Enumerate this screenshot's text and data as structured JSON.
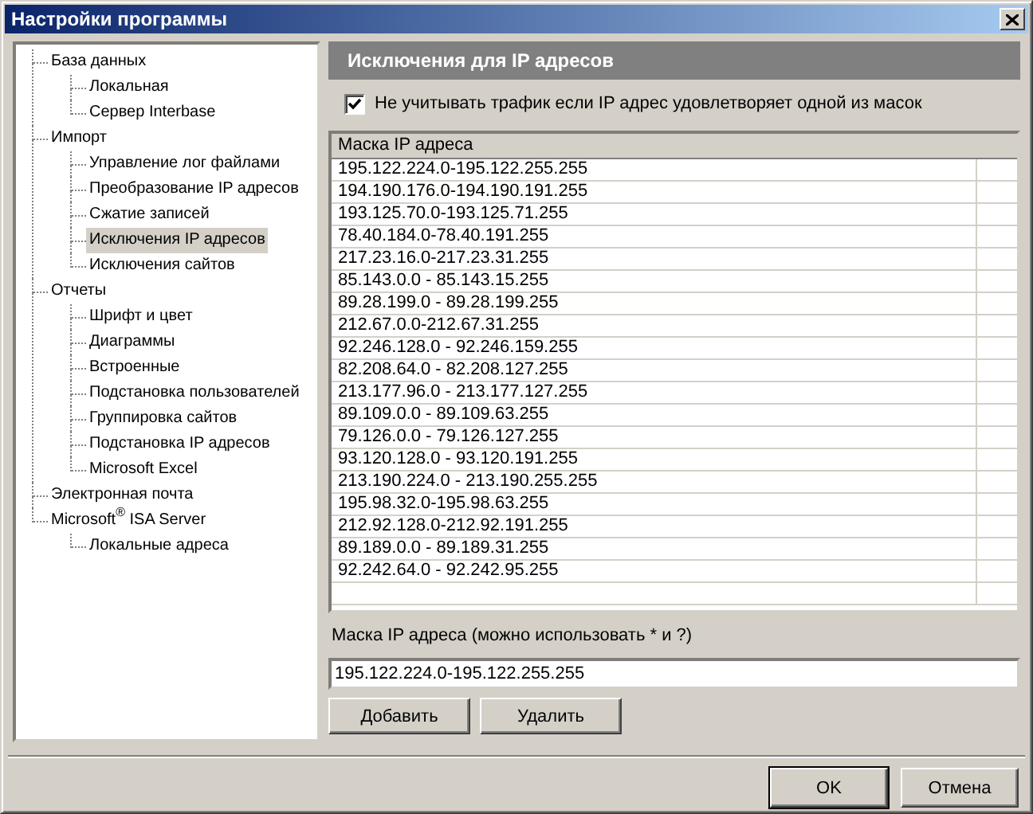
{
  "window": {
    "title": "Настройки программы"
  },
  "tree": [
    {
      "label": "База данных",
      "selected": false,
      "children": [
        {
          "label": "Локальная",
          "selected": false
        },
        {
          "label": "Сервер Interbase",
          "selected": false
        }
      ]
    },
    {
      "label": "Импорт",
      "selected": false,
      "children": [
        {
          "label": "Управление лог файлами",
          "selected": false
        },
        {
          "label": "Преобразование IP адресов",
          "selected": false
        },
        {
          "label": "Сжатие записей",
          "selected": false
        },
        {
          "label": "Исключения IP адресов",
          "selected": true
        },
        {
          "label": "Исключения сайтов",
          "selected": false
        }
      ]
    },
    {
      "label": "Отчеты",
      "selected": false,
      "children": [
        {
          "label": "Шрифт и цвет",
          "selected": false
        },
        {
          "label": "Диаграммы",
          "selected": false
        },
        {
          "label": "Встроенные",
          "selected": false
        },
        {
          "label": "Подстановка пользователей",
          "selected": false
        },
        {
          "label": "Группировка сайтов",
          "selected": false
        },
        {
          "label": "Подстановка IP адресов",
          "selected": false
        },
        {
          "label": "Microsoft Excel",
          "selected": false
        }
      ]
    },
    {
      "label": "Электронная почта",
      "selected": false
    },
    {
      "label": "Microsoft$^{®}$ ISA Server",
      "selected": false,
      "children": [
        {
          "label": "Локальные адреса",
          "selected": false
        }
      ]
    }
  ],
  "panel": {
    "title": "Исключения для IP адресов",
    "checkbox": {
      "label": "Не учитывать трафик если IP адрес удовлетворяет одной из масок",
      "checked": true
    },
    "table": {
      "columns": [
        "Маска IP адреса"
      ],
      "rows": [
        "195.122.224.0-195.122.255.255",
        "194.190.176.0-194.190.191.255",
        "193.125.70.0-193.125.71.255",
        "78.40.184.0-78.40.191.255",
        "217.23.16.0-217.23.31.255",
        "85.143.0.0 - 85.143.15.255",
        "89.28.199.0 - 89.28.199.255",
        "212.67.0.0-212.67.31.255",
        "92.246.128.0 - 92.246.159.255",
        "82.208.64.0 - 82.208.127.255",
        "213.177.96.0 - 213.177.127.255",
        "89.109.0.0 - 89.109.63.255",
        "79.126.0.0 - 79.126.127.255",
        "93.120.128.0 - 93.120.191.255",
        "213.190.224.0 - 213.190.255.255",
        "195.98.32.0-195.98.63.255",
        "212.92.128.0-212.92.191.255",
        "89.189.0.0 - 89.189.31.255",
        "92.242.64.0 - 92.242.95.255"
      ]
    },
    "field": {
      "label": "Маска IP адреса (можно использовать * и ?)",
      "value": "195.122.224.0-195.122.255.255"
    },
    "buttons": [
      "Добавить",
      "Удалить"
    ]
  },
  "footer_buttons": [
    {
      "label": "OK",
      "default": true
    },
    {
      "label": "Отмена",
      "default": false
    }
  ]
}
